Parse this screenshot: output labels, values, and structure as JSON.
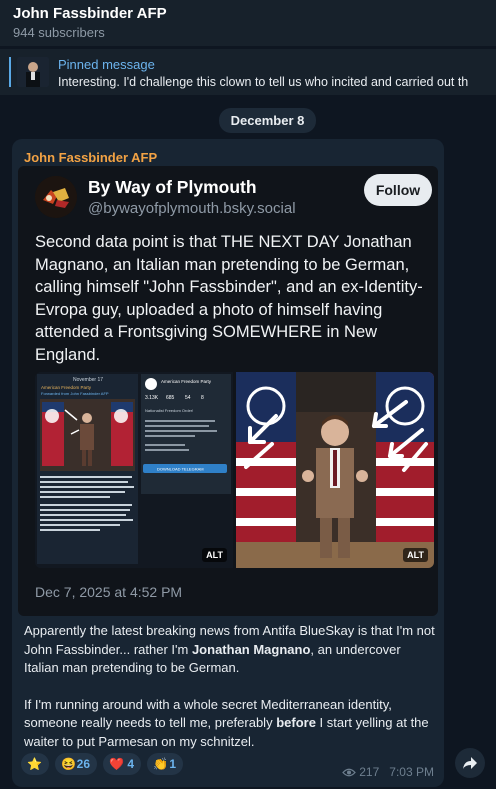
{
  "channel": {
    "title": "John Fassbinder AFP",
    "subscribers": "944 subscribers"
  },
  "pinned": {
    "title": "Pinned message",
    "text": "Interesting. I'd challenge this clown to tell us who incited and carried out th"
  },
  "date_separator": "December 8",
  "message": {
    "author": "John Fassbinder AFP",
    "embed": {
      "display_name": "By Way of Plymouth",
      "handle": "@bywayofplymouth.bsky.social",
      "follow_label": "Follow",
      "text": "Second data point is that THE NEXT DAY Jonathan Magnano, an Italian man pretending to be German, calling himself \"John Fassbinder\", and an ex-Identity-Evropa guy, uploaded a photo of himself having attended a Frontsgiving SOMEWHERE in New England.",
      "images": [
        {
          "alt_label": "ALT",
          "inner": {
            "date": "November 17",
            "title": "American Freedom Party",
            "forwarded": "Forwarded from John Fassbinder AFP",
            "stat1": "3.13K",
            "stat2": "685",
            "stat3": "54",
            "stat4": "8",
            "greeting": "Nationalist Freedom Order!",
            "button": "DOWNLOAD TELEGRAM"
          }
        },
        {
          "alt_label": "ALT"
        }
      ],
      "date": "Dec 7, 2025 at 4:52 PM"
    },
    "body_p1_a": "Apparently the latest breaking news from Antifa BlueSkay is that I'm not John Fassbinder... rather I'm ",
    "body_p1_bold": "Jonathan Magnano",
    "body_p1_b": ", an undercover Italian man pretending to be German.",
    "body_p2_a": "If I'm running around with a whole secret Mediterranean identity, someone really needs to tell me, preferably ",
    "body_p2_bold": "before",
    "body_p2_b": " I start yelling at the waiter to put Parmesan on my schnitzel.",
    "reactions": [
      {
        "emoji": "⭐",
        "count": ""
      },
      {
        "emoji": "😆",
        "count": "26"
      },
      {
        "emoji": "❤️",
        "count": "4"
      },
      {
        "emoji": "👏",
        "count": "1"
      }
    ],
    "views": "217",
    "time": "7:03 PM"
  },
  "colors": {
    "background": "#0e1621",
    "header": "#17212b",
    "bubble": "#182533",
    "author": "#f2a244",
    "link": "#6cb4ee"
  }
}
